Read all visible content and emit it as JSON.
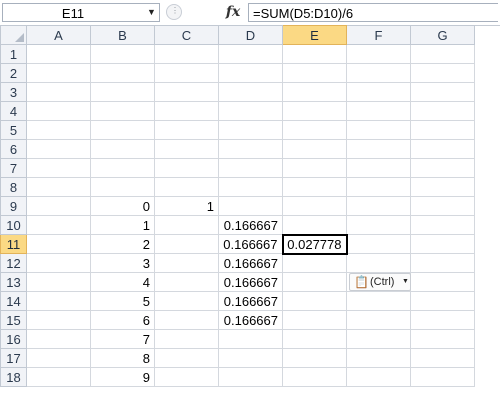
{
  "formula_bar": {
    "name_box": "E11",
    "fx_label": "fx",
    "formula": "=SUM(D5:D10)/6"
  },
  "columns": [
    "A",
    "B",
    "C",
    "D",
    "E",
    "F",
    "G"
  ],
  "selected_column": "E",
  "selected_row": "11",
  "rows": [
    {
      "num": "1",
      "cells": [
        "",
        "",
        "",
        "",
        "",
        "",
        ""
      ]
    },
    {
      "num": "2",
      "cells": [
        "",
        "",
        "",
        "",
        "",
        "",
        ""
      ]
    },
    {
      "num": "3",
      "cells": [
        "",
        "",
        "",
        "",
        "",
        "",
        ""
      ]
    },
    {
      "num": "4",
      "cells": [
        "",
        "",
        "",
        "",
        "",
        "",
        ""
      ]
    },
    {
      "num": "5",
      "cells": [
        "",
        "",
        "",
        "",
        "",
        "",
        ""
      ]
    },
    {
      "num": "6",
      "cells": [
        "",
        "",
        "",
        "",
        "",
        "",
        ""
      ]
    },
    {
      "num": "7",
      "cells": [
        "",
        "",
        "",
        "",
        "",
        "",
        ""
      ]
    },
    {
      "num": "8",
      "cells": [
        "",
        "",
        "",
        "",
        "",
        "",
        ""
      ]
    },
    {
      "num": "9",
      "cells": [
        "",
        "0",
        "1",
        "",
        "",
        "",
        ""
      ]
    },
    {
      "num": "10",
      "cells": [
        "",
        "1",
        "",
        "0.166667",
        "",
        "",
        ""
      ]
    },
    {
      "num": "11",
      "cells": [
        "",
        "2",
        "",
        "0.166667",
        "0.027778",
        "",
        ""
      ]
    },
    {
      "num": "12",
      "cells": [
        "",
        "3",
        "",
        "0.166667",
        "",
        "",
        ""
      ]
    },
    {
      "num": "13",
      "cells": [
        "",
        "4",
        "",
        "0.166667",
        "",
        "",
        ""
      ]
    },
    {
      "num": "14",
      "cells": [
        "",
        "5",
        "",
        "0.166667",
        "",
        "",
        ""
      ]
    },
    {
      "num": "15",
      "cells": [
        "",
        "6",
        "",
        "0.166667",
        "",
        "",
        ""
      ]
    },
    {
      "num": "16",
      "cells": [
        "",
        "7",
        "",
        "",
        "",
        "",
        ""
      ]
    },
    {
      "num": "17",
      "cells": [
        "",
        "8",
        "",
        "",
        "",
        "",
        ""
      ]
    },
    {
      "num": "18",
      "cells": [
        "",
        "9",
        "",
        "",
        "",
        "",
        ""
      ]
    }
  ],
  "paste_options": {
    "label": "(Ctrl)",
    "icon": "clipboard-icon"
  },
  "colors": {
    "header_bg": "#f1f3f7",
    "selected_header": "#fbd984",
    "gridline": "#d4d8de"
  }
}
